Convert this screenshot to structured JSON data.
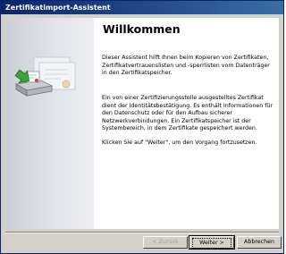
{
  "window": {
    "title": "Zertifikatimport-Assistent"
  },
  "main": {
    "title": "Willkommen",
    "paragraphs": [
      "Dieser Assistent hilft Ihnen beim Kopieren von Zertifikaten, Zertifikatvertrauenslisten und -sperrlisten vom Datenträger in den Zertifikatspeicher.",
      "Ein von einer Zertifizierungsstelle ausgestelltes Zertifikat dient der Identitätsbestätigung. Es enthält Informationen für den Datenschutz oder für den Aufbau sicherer Netzwerkverbindungen. Ein Zertifikatspeicher ist der Systembereich, in dem Zertifikate gespeichert werden.",
      "Klicken Sie auf \"Weiter\", um den Vorgang fortzusetzen."
    ]
  },
  "buttons": {
    "back": "< Zurück",
    "next": "Weiter >",
    "cancel": "Abbrechen"
  },
  "icons": {
    "side": "certificate-import-icon"
  }
}
